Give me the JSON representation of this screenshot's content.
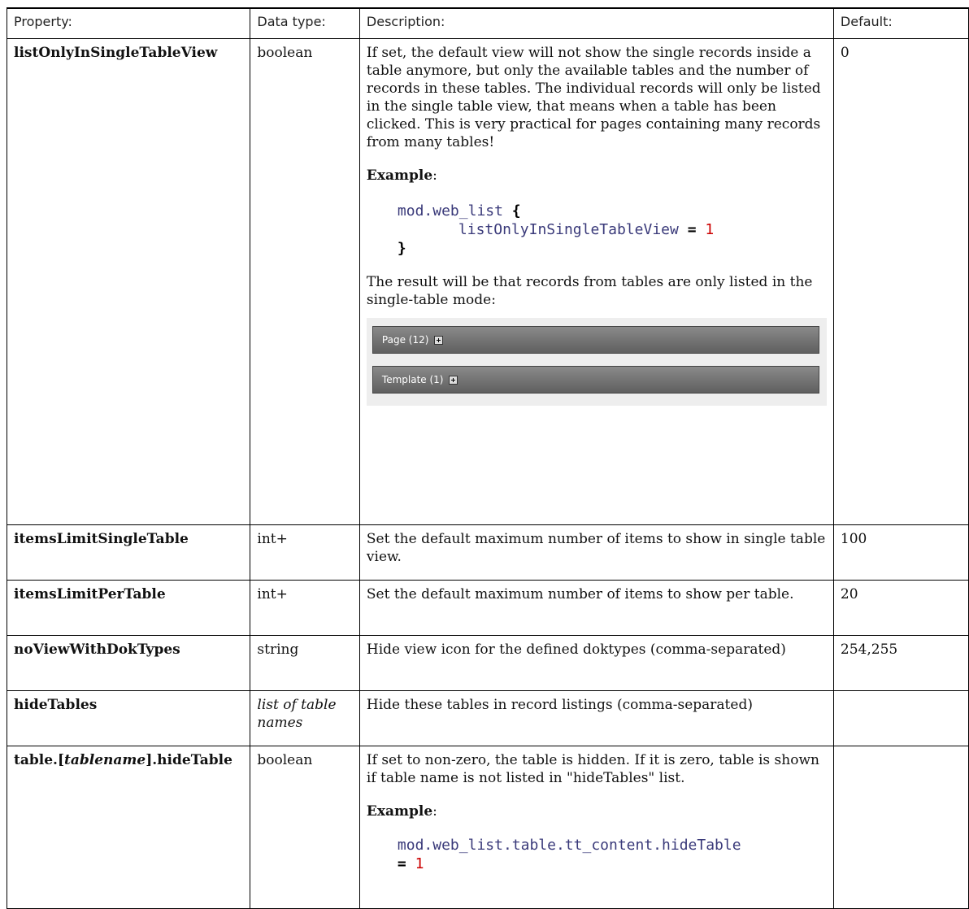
{
  "headers": {
    "property": "Property:",
    "type": "Data type:",
    "description": "Description:",
    "default": "Default:"
  },
  "rows": [
    {
      "property": "listOnlyInSingleTableView",
      "type": "boolean",
      "description": "If set, the default view will not show the single records inside a table anymore, but only the available tables and the number of records in these tables. The individual records will only be listed in the single table view, that means when a table has been clicked. This is very practical for pages containing many records from many tables!",
      "example_label": "Example",
      "example_colon": ":",
      "code_line1": "mod.web_list",
      "code_brace_open": "{",
      "code_line2": "listOnlyInSingleTableView",
      "code_equals": "=",
      "code_value": "1",
      "code_brace_close": "}",
      "result_text": "The result will be that records from tables are only listed in the single-table mode:",
      "screenshot_bars": [
        "Page (12)",
        "Template (1)"
      ],
      "default": "0"
    },
    {
      "property": "itemsLimitSingleTable",
      "type": "int+",
      "description": "Set the default maximum number of items to show in single table view.",
      "default": "100"
    },
    {
      "property": "itemsLimitPerTable",
      "type": "int+",
      "description": "Set the default maximum number of items to show per table.",
      "default": "20"
    },
    {
      "property": "noViewWithDokTypes",
      "type": "string",
      "description": "Hide view icon for the defined doktypes (comma-separated)",
      "default": "254,255"
    },
    {
      "property": "hideTables",
      "type": "list of table names",
      "description": "Hide these tables in record listings (comma-separated)",
      "default": ""
    },
    {
      "property_prefix": "table.[",
      "property_italic": "tablename",
      "property_suffix": "].hideTable",
      "type": "boolean",
      "description": "If set to non-zero, the table is hidden. If it is zero, table is shown if table name is not listed in \"hideTables\" list.",
      "example_label": "Example",
      "example_colon": ":",
      "code_line1": "mod.web_list.table.tt_content.hideTable",
      "code_equals": "=",
      "code_value": "1",
      "default": ""
    }
  ]
}
